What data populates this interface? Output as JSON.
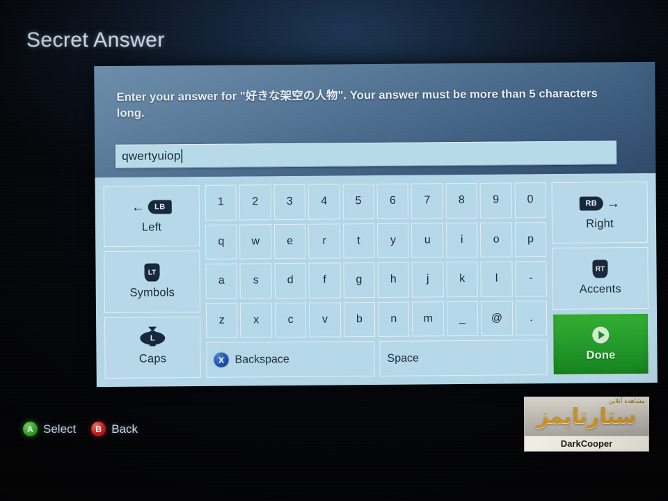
{
  "page": {
    "title": "Secret Answer"
  },
  "dialog": {
    "prompt": "Enter your answer for \"好きな架空の人物\". Your answer must be more than 5 characters long.",
    "answer_field": {
      "value": "qwertyuiop",
      "placeholder": ""
    }
  },
  "keyboard": {
    "rows": [
      [
        "1",
        "2",
        "3",
        "4",
        "5",
        "6",
        "7",
        "8",
        "9",
        "0"
      ],
      [
        "q",
        "w",
        "e",
        "r",
        "t",
        "y",
        "u",
        "i",
        "o",
        "p"
      ],
      [
        "a",
        "s",
        "d",
        "f",
        "g",
        "h",
        "j",
        "k",
        "l",
        "-"
      ],
      [
        "z",
        "x",
        "c",
        "v",
        "b",
        "n",
        "m",
        "_",
        "@",
        "."
      ]
    ],
    "backspace": {
      "label": "Backspace",
      "button_glyph": "X"
    },
    "space": {
      "label": "Space"
    },
    "left_column": [
      {
        "label": "Left",
        "glyph": "LB",
        "icon": "bumper-left-icon",
        "arrow": "←"
      },
      {
        "label": "Symbols",
        "glyph": "LT",
        "icon": "trigger-left-icon"
      },
      {
        "label": "Caps",
        "glyph": "L",
        "icon": "left-stick-click-icon"
      }
    ],
    "right_column": [
      {
        "label": "Right",
        "glyph": "RB",
        "icon": "bumper-right-icon",
        "arrow": "→"
      },
      {
        "label": "Accents",
        "glyph": "RT",
        "icon": "trigger-right-icon"
      },
      {
        "label": "Done",
        "glyph": "",
        "icon": "start-button-icon"
      }
    ]
  },
  "legend": [
    {
      "button": "A",
      "label": "Select",
      "color": "#3fae2c"
    },
    {
      "button": "B",
      "label": "Back",
      "color": "#c4201c"
    }
  ],
  "watermark": {
    "main_text": "ستارتایمز",
    "sub_text": "مشاهده آنلاین",
    "caption": "DarkCooper"
  },
  "colors": {
    "prompt_panel": "#4a6d8c",
    "keyboard_panel": "#b4d8e9",
    "input_field": "#b9dcea",
    "done_button": "#22992a",
    "title_text": "#c9d4dd"
  }
}
